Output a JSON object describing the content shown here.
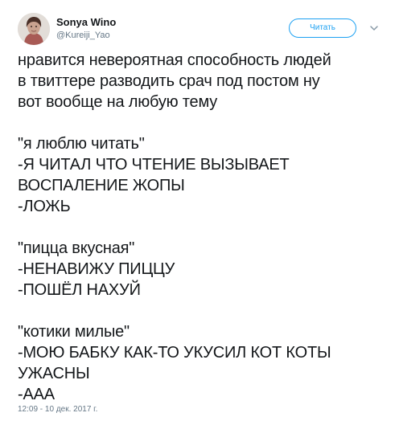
{
  "tweet": {
    "display_name": "Sonya Wino",
    "username": "@Kureiji_Yao",
    "follow_label": "Читать",
    "body_lines": [
      "нравится невероятная способность людей",
      "в твиттере разводить срач под постом ну",
      "вот вообще на любую тему",
      "",
      "\"я люблю читать\"",
      "-Я ЧИТАЛ ЧТО ЧТЕНИЕ ВЫЗЫВАЕТ",
      "ВОСПАЛЕНИЕ ЖОПЫ",
      "-ЛОЖЬ",
      "",
      "\"пицца вкусная\"",
      "-НЕНАВИЖУ ПИЦЦУ",
      "-ПОШЁЛ НАХУЙ",
      "",
      "\"котики милые\"",
      "-МОЮ БАБКУ КАК-ТО УКУСИЛ КОТ КОТЫ",
      "УЖАСНЫ",
      "-ААА"
    ],
    "timestamp": "12:09 - 10 дек. 2017 г."
  },
  "icons": {
    "avatar": "avatar-photo",
    "more": "chevron-down-icon"
  },
  "colors": {
    "accent": "#1da1f2",
    "text": "#14171a",
    "muted": "#657786",
    "background": "#ffffff"
  }
}
